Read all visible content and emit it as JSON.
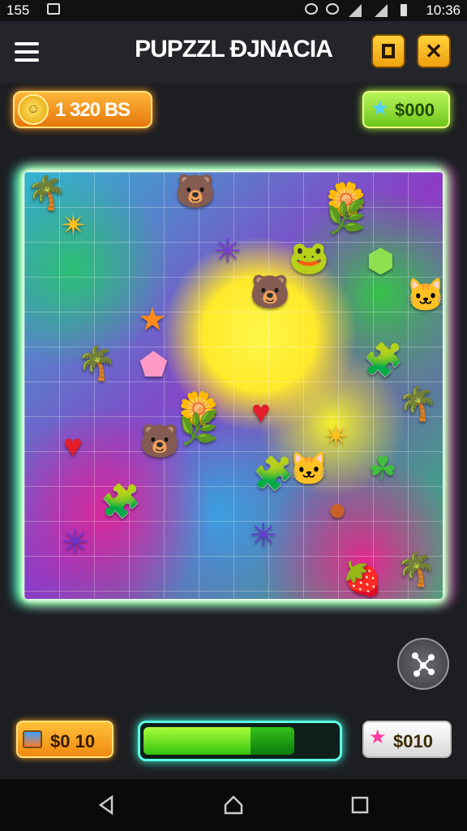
{
  "status_bar": {
    "time_left": "155",
    "time_right": "10:36"
  },
  "header": {
    "title": "PUPZZL ƉJNACIA"
  },
  "currency": {
    "coins": "1 320 BS",
    "gems": "$000"
  },
  "board": {
    "pieces": [
      {
        "icon": "palm-leaf-icon",
        "glyph": "🌴",
        "color": "#2dc99a"
      },
      {
        "icon": "bear-icon",
        "glyph": "🐻",
        "color": "#e0a030"
      },
      {
        "icon": "flower-icon",
        "glyph": "🌼",
        "color": "#ffffff"
      },
      {
        "icon": "leaf-icon",
        "glyph": "🌿",
        "color": "#3fbf3f"
      },
      {
        "icon": "star-leaf-icon",
        "glyph": "✴",
        "color": "#ffc020"
      },
      {
        "icon": "purple-leaf-icon",
        "glyph": "✳",
        "color": "#7a38d8"
      },
      {
        "icon": "frog-icon",
        "glyph": "🐸",
        "color": "#50c840"
      },
      {
        "icon": "green-gem-icon",
        "glyph": "⬢",
        "color": "#8ee050"
      },
      {
        "icon": "bear-icon",
        "glyph": "🐻",
        "color": "#e0a030"
      },
      {
        "icon": "cat-icon",
        "glyph": "🐱",
        "color": "#7ad84a"
      },
      {
        "icon": "orange-star-icon",
        "glyph": "★",
        "color": "#ff8a1a"
      },
      {
        "icon": "palm-leaf-icon",
        "glyph": "🌴",
        "color": "#3fbf3f"
      },
      {
        "icon": "pink-gem-icon",
        "glyph": "⬟",
        "color": "#ff9ac8"
      },
      {
        "icon": "puzzle-piece-icon",
        "glyph": "🧩",
        "color": "#e67ad8"
      },
      {
        "icon": "flower-icon",
        "glyph": "🌼",
        "color": "#ffffff"
      },
      {
        "icon": "leaf-icon",
        "glyph": "🌿",
        "color": "#3fbf3f"
      },
      {
        "icon": "heart-icon",
        "glyph": "♥",
        "color": "#e51c2a"
      },
      {
        "icon": "palm-leaf-icon",
        "glyph": "🌴",
        "color": "#3fbf3f"
      },
      {
        "icon": "heart-icon",
        "glyph": "♥",
        "color": "#e51c2a"
      },
      {
        "icon": "bear-icon",
        "glyph": "🐻",
        "color": "#e0a030"
      },
      {
        "icon": "star-leaf-icon",
        "glyph": "✴",
        "color": "#ffc020"
      },
      {
        "icon": "cat-icon",
        "glyph": "🐱",
        "color": "#50c840"
      },
      {
        "icon": "puzzle-piece-icon",
        "glyph": "🧩",
        "color": "#ffd21a"
      },
      {
        "icon": "clover-icon",
        "glyph": "☘",
        "color": "#3fbf3f"
      },
      {
        "icon": "puzzle-piece-icon",
        "glyph": "🧩",
        "color": "#e67ad8"
      },
      {
        "icon": "owl-icon",
        "glyph": "●",
        "color": "#c8602a"
      },
      {
        "icon": "purple-leaf-icon",
        "glyph": "✳",
        "color": "#6a38d8"
      },
      {
        "icon": "purple-leaf-icon",
        "glyph": "✳",
        "color": "#6a38d8"
      },
      {
        "icon": "strawberry-icon",
        "glyph": "🍓",
        "color": "#e51c2a"
      },
      {
        "icon": "palm-leaf-icon",
        "glyph": "🌴",
        "color": "#3fbf3f"
      }
    ]
  },
  "bottom": {
    "left_value": "$0 10",
    "right_value": "$010",
    "progress": 0.78
  },
  "colors": {
    "accent": "#f5a623",
    "glow_green": "#7fff5a",
    "progress": "#5fd21a"
  }
}
